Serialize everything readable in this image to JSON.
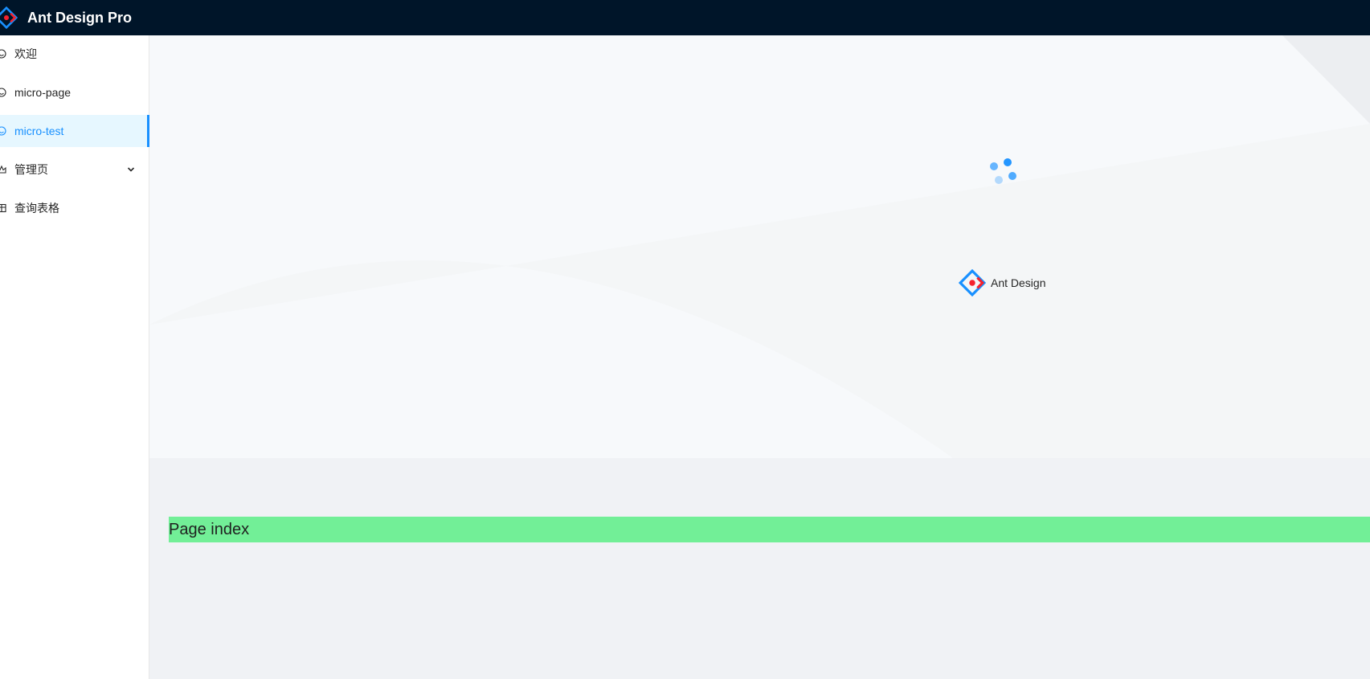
{
  "header": {
    "title": "Ant Design Pro",
    "logo": "ant-design-logo"
  },
  "sidebar": {
    "items": [
      {
        "label": "欢迎",
        "icon": "smile-icon",
        "active": false
      },
      {
        "label": "micro-page",
        "icon": "smile-icon",
        "active": false
      },
      {
        "label": "micro-test",
        "icon": "smile-icon",
        "active": true
      },
      {
        "label": "管理页",
        "icon": "crown-icon",
        "active": false,
        "expandable": true
      },
      {
        "label": "查询表格",
        "icon": "table-icon",
        "active": false
      }
    ]
  },
  "main": {
    "loader": {
      "brand_text": "Ant Design"
    },
    "page_index_text": "Page index"
  },
  "colors": {
    "header_bg": "#001529",
    "accent": "#1890ff",
    "active_bg": "#e6f7ff",
    "page_index_bg": "#72ef97",
    "content_bg": "#f0f2f5"
  }
}
